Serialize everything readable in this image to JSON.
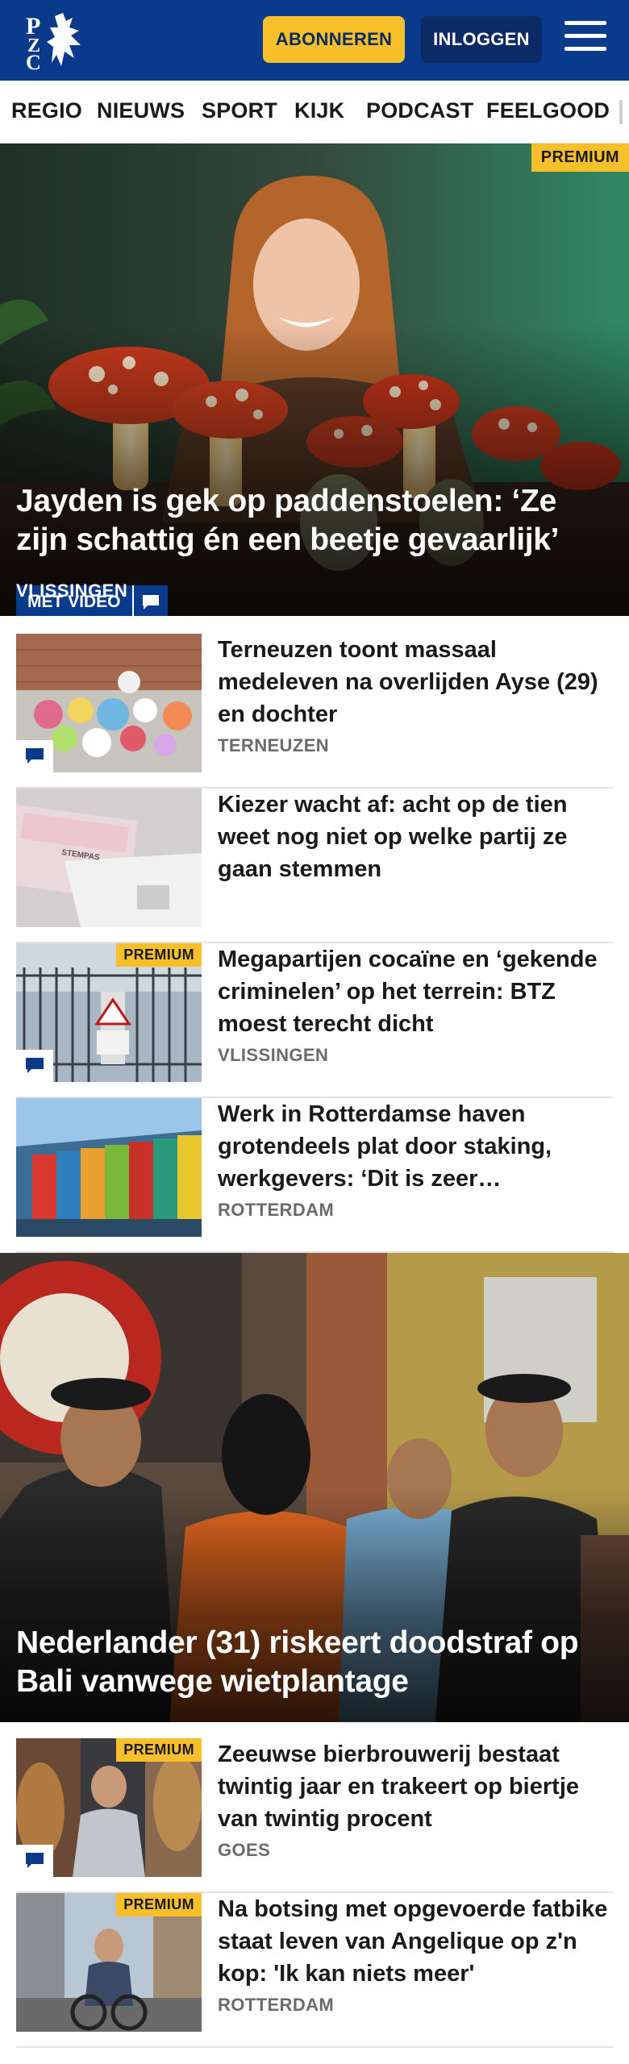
{
  "header": {
    "logo_text": "PZC",
    "subscribe_label": "ABONNEREN",
    "login_label": "INLOGGEN",
    "menu_icon": "hamburger-icon"
  },
  "nav": {
    "items": [
      "REGIO",
      "NIEUWS",
      "SPORT",
      "KIJK",
      "PODCAST",
      "FEELGOOD"
    ]
  },
  "hero1": {
    "premium_label": "PREMIUM",
    "video_label": "MET VIDEO",
    "title": "Jayden is gek op paddenstoelen: ‘Ze zijn schattig én een beetje gevaarlijk’",
    "location": "VLISSINGEN"
  },
  "articles": [
    {
      "title": "Terneuzen toont massaal medeleven na overlijden Ayse (29) en dochter",
      "location": "TERNEUZEN",
      "premium": "",
      "comments": true
    },
    {
      "title": "Kiezer wacht af: acht op de tien weet nog niet op welke partij ze gaan stemmen",
      "location": "",
      "premium": "",
      "comments": false,
      "thumb_text": "STEMPAS"
    },
    {
      "title": "Megapartijen cocaïne en ‘gekende criminelen’ op het terrein: BTZ moest terecht dicht",
      "location": "VLISSINGEN",
      "premium": "PREMIUM",
      "comments": true
    },
    {
      "title": "Werk in Rotterdamse haven grotendeels plat door staking, werkgevers: ‘Dit is zeer…",
      "location": "ROTTERDAM",
      "premium": "",
      "comments": false
    }
  ],
  "hero2": {
    "title": "Nederlander (31) riskeert doodstraf op Bali vanwege wietplantage"
  },
  "articles2": [
    {
      "title": "Zeeuwse bierbrouwerij bestaat twintig jaar en trakeert op biertje van twintig procent",
      "location": "GOES",
      "premium": "PREMIUM",
      "comments": true
    },
    {
      "title": "Na botsing met opgevoerde fatbike staat leven van Angelique op z'n kop: 'Ik kan niets meer'",
      "location": "ROTTERDAM",
      "premium": "PREMIUM",
      "comments": false
    }
  ],
  "colors": {
    "brand_blue": "#0a3a8c",
    "accent_yellow": "#f7c02b",
    "muted_text": "#6b6b6b"
  }
}
